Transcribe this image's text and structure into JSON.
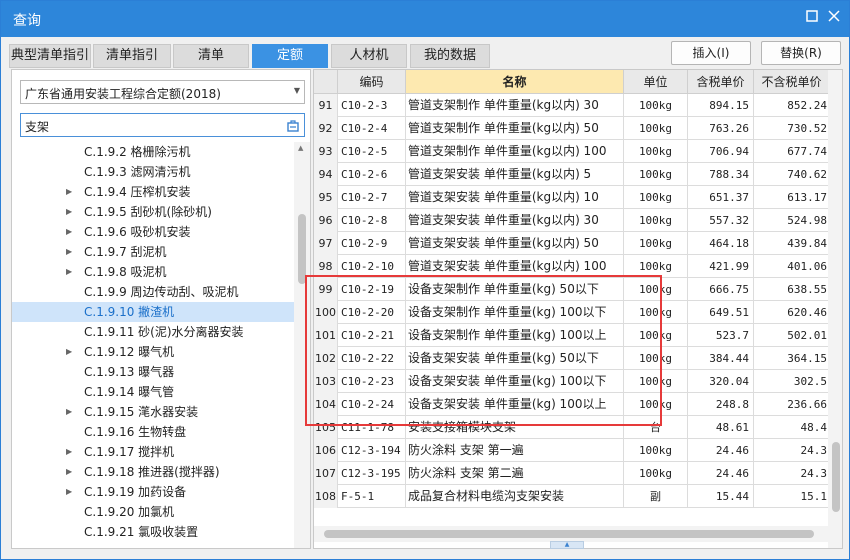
{
  "window": {
    "title": "查询"
  },
  "tabs": [
    {
      "label": "典型清单指引",
      "active": false
    },
    {
      "label": "清单指引",
      "active": false
    },
    {
      "label": "清单",
      "active": false
    },
    {
      "label": "定额",
      "active": true
    },
    {
      "label": "人材机",
      "active": false
    },
    {
      "label": "我的数据",
      "active": false
    }
  ],
  "actions": {
    "insert": "插入(I)",
    "replace": "替换(R)"
  },
  "left": {
    "quota_set": "广东省通用安装工程综合定额(2018)",
    "search_value": "支架",
    "tree": [
      {
        "label": "C.1.9.2 格栅除污机",
        "expandable": false,
        "selected": false
      },
      {
        "label": "C.1.9.3 滤网清污机",
        "expandable": false,
        "selected": false
      },
      {
        "label": "C.1.9.4 压榨机安装",
        "expandable": true,
        "selected": false
      },
      {
        "label": "C.1.9.5 刮砂机(除砂机)",
        "expandable": true,
        "selected": false
      },
      {
        "label": "C.1.9.6 吸砂机安装",
        "expandable": true,
        "selected": false
      },
      {
        "label": "C.1.9.7 刮泥机",
        "expandable": true,
        "selected": false
      },
      {
        "label": "C.1.9.8 吸泥机",
        "expandable": true,
        "selected": false
      },
      {
        "label": "C.1.9.9 周边传动刮、吸泥机",
        "expandable": false,
        "selected": false
      },
      {
        "label": "C.1.9.10 撇渣机",
        "expandable": false,
        "selected": true
      },
      {
        "label": "C.1.9.11 砂(泥)水分离器安装",
        "expandable": false,
        "selected": false
      },
      {
        "label": "C.1.9.12 曝气机",
        "expandable": true,
        "selected": false
      },
      {
        "label": "C.1.9.13 曝气器",
        "expandable": false,
        "selected": false
      },
      {
        "label": "C.1.9.14 曝气管",
        "expandable": false,
        "selected": false
      },
      {
        "label": "C.1.9.15 滗水器安装",
        "expandable": true,
        "selected": false
      },
      {
        "label": "C.1.9.16 生物转盘",
        "expandable": false,
        "selected": false
      },
      {
        "label": "C.1.9.17 搅拌机",
        "expandable": true,
        "selected": false
      },
      {
        "label": "C.1.9.18 推进器(搅拌器)",
        "expandable": true,
        "selected": false
      },
      {
        "label": "C.1.9.19 加药设备",
        "expandable": true,
        "selected": false
      },
      {
        "label": "C.1.9.20 加氯机",
        "expandable": false,
        "selected": false
      },
      {
        "label": "C.1.9.21 氯吸收装置",
        "expandable": false,
        "selected": false
      }
    ]
  },
  "grid": {
    "headers": {
      "no": "",
      "code": "编码",
      "name": "名称",
      "unit": "单位",
      "tax_price": "含税单价",
      "notax_price": "不含税单价"
    },
    "rows": [
      {
        "no": "91",
        "code": "C10-2-3",
        "name": "管道支架制作 单件重量(kg以内) 30",
        "unit": "100kg",
        "tax": "894.15",
        "notax": "852.24"
      },
      {
        "no": "92",
        "code": "C10-2-4",
        "name": "管道支架制作 单件重量(kg以内) 50",
        "unit": "100kg",
        "tax": "763.26",
        "notax": "730.52"
      },
      {
        "no": "93",
        "code": "C10-2-5",
        "name": "管道支架制作 单件重量(kg以内) 100",
        "unit": "100kg",
        "tax": "706.94",
        "notax": "677.74"
      },
      {
        "no": "94",
        "code": "C10-2-6",
        "name": "管道支架安装 单件重量(kg以内) 5",
        "unit": "100kg",
        "tax": "788.34",
        "notax": "740.62"
      },
      {
        "no": "95",
        "code": "C10-2-7",
        "name": "管道支架安装 单件重量(kg以内) 10",
        "unit": "100kg",
        "tax": "651.37",
        "notax": "613.17"
      },
      {
        "no": "96",
        "code": "C10-2-8",
        "name": "管道支架安装 单件重量(kg以内) 30",
        "unit": "100kg",
        "tax": "557.32",
        "notax": "524.98"
      },
      {
        "no": "97",
        "code": "C10-2-9",
        "name": "管道支架安装 单件重量(kg以内) 50",
        "unit": "100kg",
        "tax": "464.18",
        "notax": "439.84"
      },
      {
        "no": "98",
        "code": "C10-2-10",
        "name": "管道支架安装 单件重量(kg以内) 100",
        "unit": "100kg",
        "tax": "421.99",
        "notax": "401.06"
      },
      {
        "no": "99",
        "code": "C10-2-19",
        "name": "设备支架制作 单件重量(kg) 50以下",
        "unit": "100kg",
        "tax": "666.75",
        "notax": "638.55"
      },
      {
        "no": "100",
        "code": "C10-2-20",
        "name": "设备支架制作 单件重量(kg) 100以下",
        "unit": "100kg",
        "tax": "649.51",
        "notax": "620.46"
      },
      {
        "no": "101",
        "code": "C10-2-21",
        "name": "设备支架制作 单件重量(kg) 100以上",
        "unit": "100kg",
        "tax": "523.7",
        "notax": "502.01"
      },
      {
        "no": "102",
        "code": "C10-2-22",
        "name": "设备支架安装 单件重量(kg) 50以下",
        "unit": "100kg",
        "tax": "384.44",
        "notax": "364.15"
      },
      {
        "no": "103",
        "code": "C10-2-23",
        "name": "设备支架安装 单件重量(kg) 100以下",
        "unit": "100kg",
        "tax": "320.04",
        "notax": "302.5"
      },
      {
        "no": "104",
        "code": "C10-2-24",
        "name": "设备支架安装 单件重量(kg) 100以上",
        "unit": "100kg",
        "tax": "248.8",
        "notax": "236.66"
      },
      {
        "no": "105",
        "code": "C11-1-78",
        "name": "安装支接箱模块支架",
        "unit": "台",
        "tax": "48.61",
        "notax": "48.4"
      },
      {
        "no": "106",
        "code": "C12-3-194",
        "name": "防火涂料 支架 第一遍",
        "unit": "100kg",
        "tax": "24.46",
        "notax": "24.3"
      },
      {
        "no": "107",
        "code": "C12-3-195",
        "name": "防火涂料 支架 第二遍",
        "unit": "100kg",
        "tax": "24.46",
        "notax": "24.3"
      },
      {
        "no": "108",
        "code": "F-5-1",
        "name": "成品复合材料电缆沟支架安装",
        "unit": "副",
        "tax": "15.44",
        "notax": "15.1"
      }
    ]
  },
  "icons": {
    "maximize": "maximize-icon",
    "close": "close-icon",
    "search": "search-icon",
    "dropdown": "chevron-down-icon"
  },
  "colors": {
    "titlebar": "#2d86da",
    "active_tab": "#3b92e3",
    "highlight_border": "#e63a3a",
    "name_header": "#fde9b0",
    "selected_node": "#cfe4fa"
  }
}
